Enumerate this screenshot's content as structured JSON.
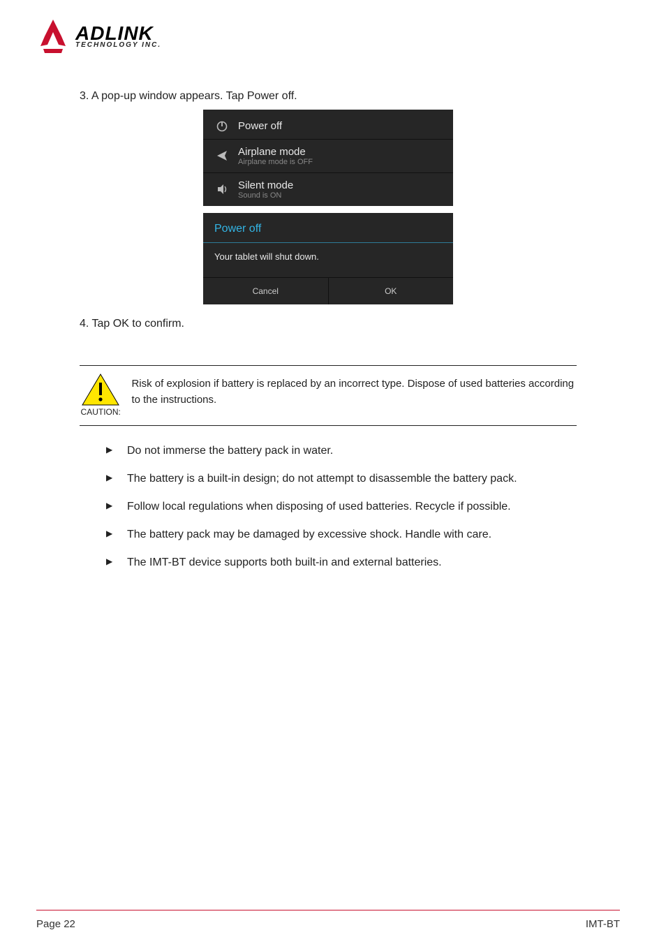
{
  "logo": {
    "main": "ADLINK",
    "sub": "TECHNOLOGY INC."
  },
  "intro": "3. A pop-up window appears. Tap Power off.",
  "confirm": "4. Tap OK to confirm.",
  "menu": {
    "item0": {
      "title": "Power off"
    },
    "item1": {
      "title": "Airplane mode",
      "sub": "Airplane mode is OFF"
    },
    "item2": {
      "title": "Silent mode",
      "sub": "Sound is ON"
    }
  },
  "dialog": {
    "title": "Power off",
    "body": "Your tablet will shut down.",
    "cancel": "Cancel",
    "ok": "OK"
  },
  "caution": {
    "label": "CAUTION:",
    "text": "Risk of explosion if battery is replaced by an incorrect type. Dispose of used batteries according to the instructions."
  },
  "bullets": [
    "Do not immerse the battery pack in water.",
    "The battery is a built-in design; do not attempt to disassemble the battery pack.",
    "Follow local regulations when disposing of used batteries. Recycle if possible.",
    "The battery pack may be damaged by excessive shock. Handle with care.",
    "The IMT-BT device supports both built-in and external batteries."
  ],
  "footer": {
    "left": "Page 22",
    "right": "IMT-BT"
  }
}
